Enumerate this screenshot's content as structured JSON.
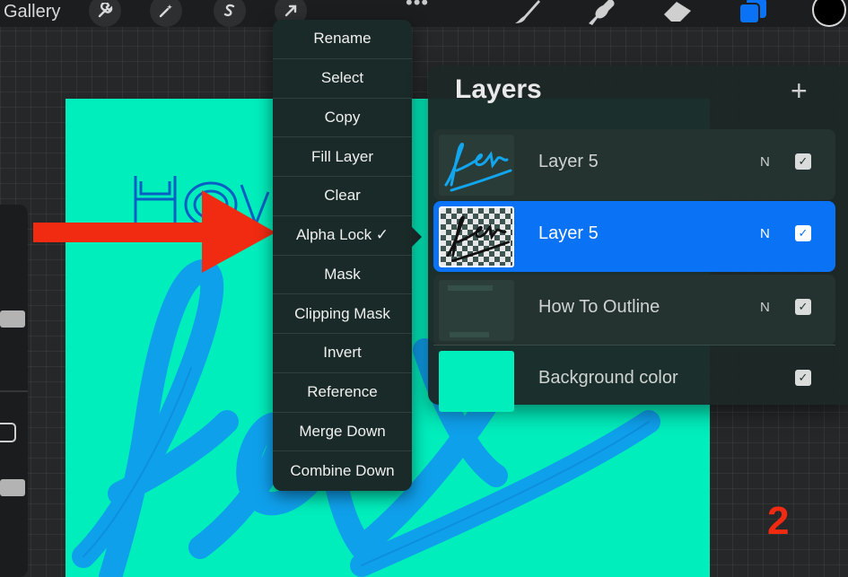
{
  "toolbar": {
    "gallery_label": "Gallery",
    "left_tools": [
      "wrench-icon",
      "magic-wand-icon",
      "selection-s-icon",
      "transform-arrow-icon"
    ],
    "right_tools": [
      "brush-icon",
      "smudge-icon",
      "eraser-icon",
      "layers-icon"
    ],
    "active_color": "#000000",
    "accent_color": "#0a72f5"
  },
  "context_menu": {
    "items": [
      {
        "label": "Rename"
      },
      {
        "label": "Select"
      },
      {
        "label": "Copy"
      },
      {
        "label": "Fill Layer"
      },
      {
        "label": "Clear"
      },
      {
        "label": "Alpha Lock ✓"
      },
      {
        "label": "Mask"
      },
      {
        "label": "Clipping Mask"
      },
      {
        "label": "Invert"
      },
      {
        "label": "Reference"
      },
      {
        "label": "Merge Down"
      },
      {
        "label": "Combine Down"
      }
    ]
  },
  "layers_panel": {
    "title": "Layers",
    "layers": [
      {
        "name": "Layer 5",
        "blend": "N",
        "visible": true,
        "selected": false
      },
      {
        "name": "Layer 5",
        "blend": "N",
        "visible": true,
        "selected": true
      },
      {
        "name": "How To Outline",
        "blend": "N",
        "visible": true,
        "selected": false
      },
      {
        "name": "Background color",
        "blend": "",
        "visible": true,
        "selected": false
      }
    ],
    "background_color": "#00edbc"
  },
  "annotation": {
    "step_number": "2",
    "color": "#f12b12"
  }
}
